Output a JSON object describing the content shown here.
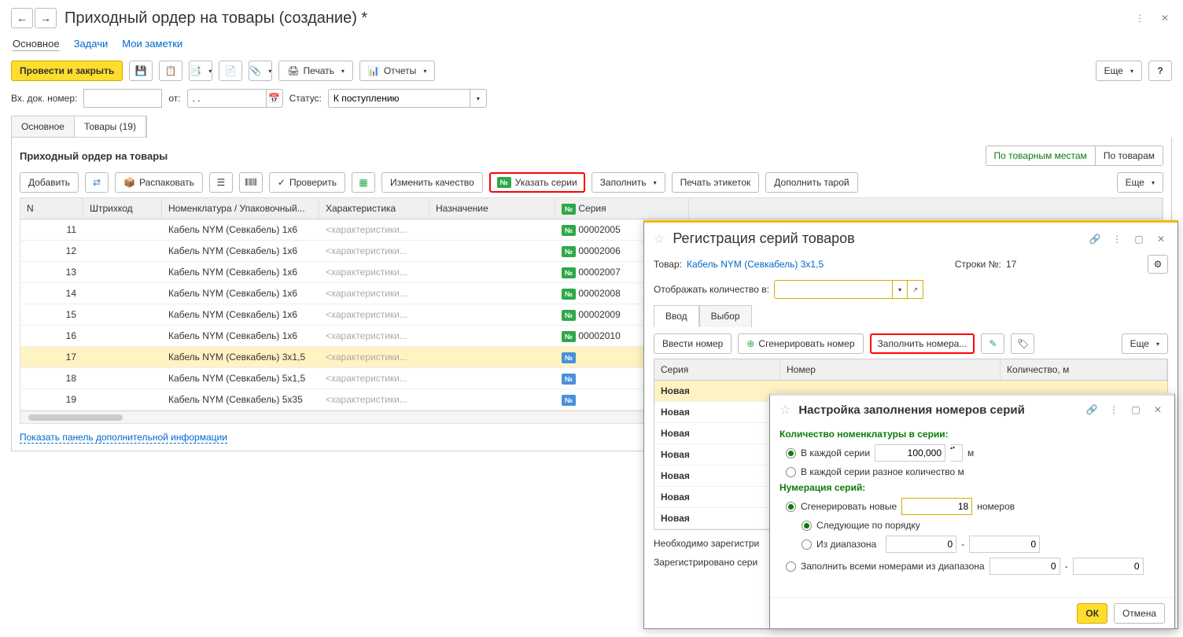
{
  "header": {
    "title": "Приходный ордер на товары (создание) *"
  },
  "top_tabs": {
    "t1": "Основное",
    "t2": "Задачи",
    "t3": "Мои заметки"
  },
  "toolbar": {
    "post_close": "Провести и закрыть",
    "print": "Печать",
    "reports": "Отчеты",
    "more": "Еще",
    "help": "?"
  },
  "form": {
    "ext_doc_label": "Вх. док. номер:",
    "ext_doc_value": "",
    "from_label": "от:",
    "date_value": ". .",
    "status_label": "Статус:",
    "status_value": "К поступлению"
  },
  "section_tabs": {
    "main": "Основное",
    "goods": "Товары (19)"
  },
  "goods_panel": {
    "title": "Приходный ордер на товары",
    "by_places": "По товарным местам",
    "by_goods": "По товарам",
    "add": "Добавить",
    "unpack": "Распаковать",
    "verify": "Проверить",
    "change_quality": "Изменить качество",
    "set_series": "Указать серии",
    "fill": "Заполнить",
    "print_labels": "Печать этикеток",
    "supplement_tare": "Дополнить тарой",
    "more": "Еще"
  },
  "table": {
    "headers": {
      "n": "N",
      "barcode": "Штрихкод",
      "nomenclature": "Номенклатура / Упаковочный...",
      "characteristic": "Характеристика",
      "purpose": "Назначение",
      "series": "Серия"
    },
    "char_placeholder": "<характеристики...",
    "rows": [
      {
        "n": "11",
        "nom": "Кабель NYM (Севкабель) 1x6",
        "series": "00002005",
        "badge": "green"
      },
      {
        "n": "12",
        "nom": "Кабель NYM (Севкабель) 1x6",
        "series": "00002006",
        "badge": "green"
      },
      {
        "n": "13",
        "nom": "Кабель NYM (Севкабель) 1x6",
        "series": "00002007",
        "badge": "green"
      },
      {
        "n": "14",
        "nom": "Кабель NYM (Севкабель) 1x6",
        "series": "00002008",
        "badge": "green"
      },
      {
        "n": "15",
        "nom": "Кабель NYM (Севкабель) 1x6",
        "series": "00002009",
        "badge": "green"
      },
      {
        "n": "16",
        "nom": "Кабель NYM (Севкабель) 1x6",
        "series": "00002010",
        "badge": "green"
      },
      {
        "n": "17",
        "nom": "Кабель NYM (Севкабель) 3x1,5",
        "series": "",
        "badge": "blue",
        "selected": true
      },
      {
        "n": "18",
        "nom": "Кабель NYM (Севкабель) 5x1,5",
        "series": "",
        "badge": "blue"
      },
      {
        "n": "19",
        "nom": "Кабель NYM (Севкабель) 5x35",
        "series": "",
        "badge": "blue"
      }
    ]
  },
  "bottom_link": "Показать панель дополнительной информации",
  "reg_dialog": {
    "title": "Регистрация серий товаров",
    "goods_label": "Товар:",
    "goods_value": "Кабель NYM (Севкабель) 3x1,5",
    "lines_label": "Строки №:",
    "lines_value": "17",
    "show_qty_label": "Отображать количество в:",
    "tab_input": "Ввод",
    "tab_select": "Выбор",
    "enter_number": "Ввести номер",
    "generate_number": "Сгенерировать номер",
    "fill_numbers": "Заполнить номера...",
    "more": "Еще",
    "col_series": "Серия",
    "col_number": "Номер",
    "col_qty": "Количество, м",
    "new_label": "Новая",
    "need_reg": "Необходимо зарегистри",
    "registered": "Зарегистрировано сери"
  },
  "settings_dialog": {
    "title": "Настройка заполнения номеров серий",
    "qty_section": "Количество номенклатуры в серии:",
    "each_series": "В каждой серии",
    "each_series_qty": "100,000",
    "unit_m": "м",
    "each_series_diff": "В каждой серии разное количество м",
    "numbering_section": "Нумерация серий:",
    "generate_new": "Сгенерировать новые",
    "generate_qty": "18",
    "numbers_suffix": "номеров",
    "next_in_order": "Следующие по порядку",
    "from_range": "Из диапазона",
    "fill_all": "Заполнить всеми номерами из диапазона",
    "range_from": "0",
    "range_to": "0",
    "range2_from": "0",
    "range2_to": "0",
    "ok": "ОК",
    "cancel": "Отмена"
  }
}
